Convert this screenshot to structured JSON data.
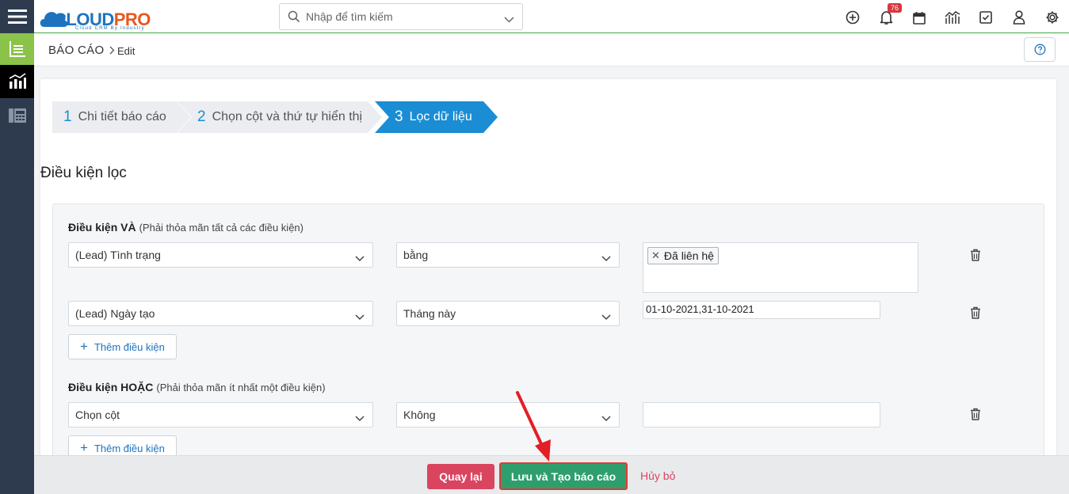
{
  "sidebar": {
    "icons": [
      "menu-icon",
      "list-report-icon",
      "chart-icon",
      "phone-book-icon"
    ],
    "active_bg": "#8bc34a"
  },
  "header": {
    "logo_main_1": "CLOUD",
    "logo_main_2": "PRO",
    "logo_sub": "Cloud CRM By Industry",
    "search_placeholder": "Nhập để tìm kiếm",
    "notification_count": "76",
    "icons": [
      "plus-circle-icon",
      "bell-icon",
      "calendar-icon",
      "chart-line-icon",
      "checkbox-icon",
      "user-icon",
      "gear-icon"
    ]
  },
  "breadcrumb": {
    "section": "BÁO CÁO",
    "page": "Edit"
  },
  "wizard": {
    "steps": [
      {
        "num": "1",
        "label": "Chi tiết báo cáo"
      },
      {
        "num": "2",
        "label": "Chọn cột và thứ tự hiển thị"
      },
      {
        "num": "3",
        "label": "Lọc dữ liệu"
      }
    ],
    "active_step": 3,
    "active_color": "#1a8dd4"
  },
  "filter": {
    "title": "Điều kiện lọc",
    "and_group": {
      "title": "Điều kiện VÀ",
      "note": "(Phải thỏa mãn tất cả các điều kiện)",
      "rows": [
        {
          "field": "(Lead) Tình trạng",
          "operator": "bằng",
          "tag": "Đã liên hệ"
        },
        {
          "field": "(Lead) Ngày tạo",
          "operator": "Tháng này",
          "value": "01-10-2021,31-10-2021"
        }
      ],
      "add_label": "Thêm điều kiện"
    },
    "or_group": {
      "title": "Điều kiện HOẶC",
      "note": "(Phải thỏa mãn ít nhất một điều kiện)",
      "rows": [
        {
          "field": "Chọn cột",
          "operator": "Không",
          "value": ""
        }
      ],
      "add_label": "Thêm điều kiện"
    }
  },
  "footer": {
    "back_label": "Quay lại",
    "save_label": "Lưu và Tạo báo cáo",
    "cancel_label": "Hủy bỏ"
  }
}
